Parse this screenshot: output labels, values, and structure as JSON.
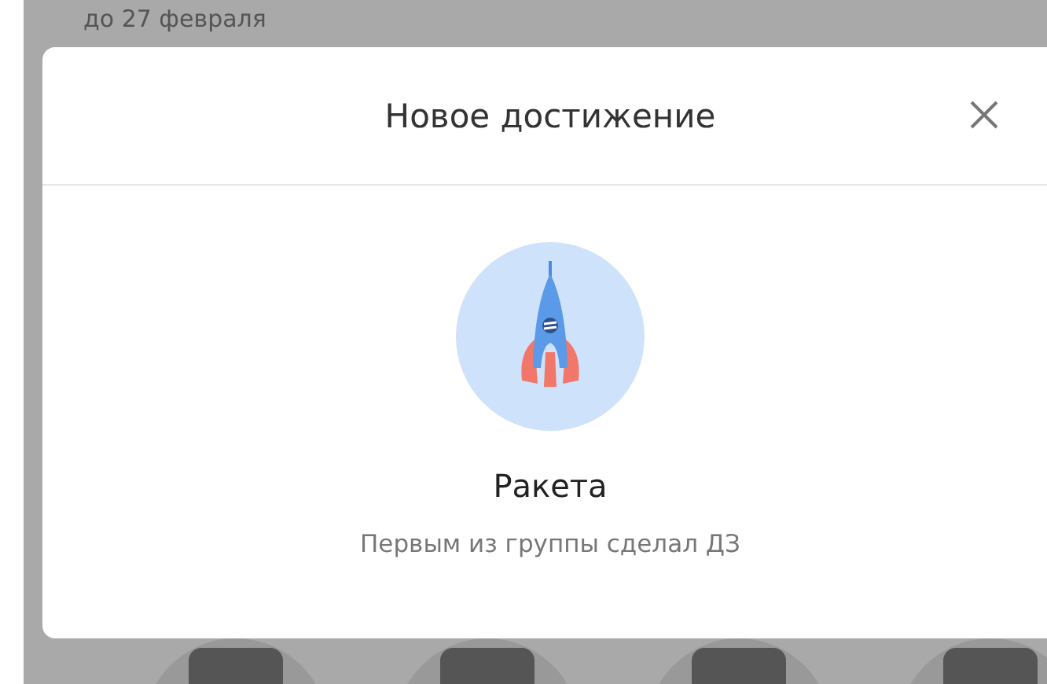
{
  "background": {
    "deadline": "до 27 февраля"
  },
  "dialog": {
    "title": "Новое достижение",
    "achievement": {
      "name": "Ракета",
      "description": "Первым из группы сделал ДЗ"
    }
  }
}
